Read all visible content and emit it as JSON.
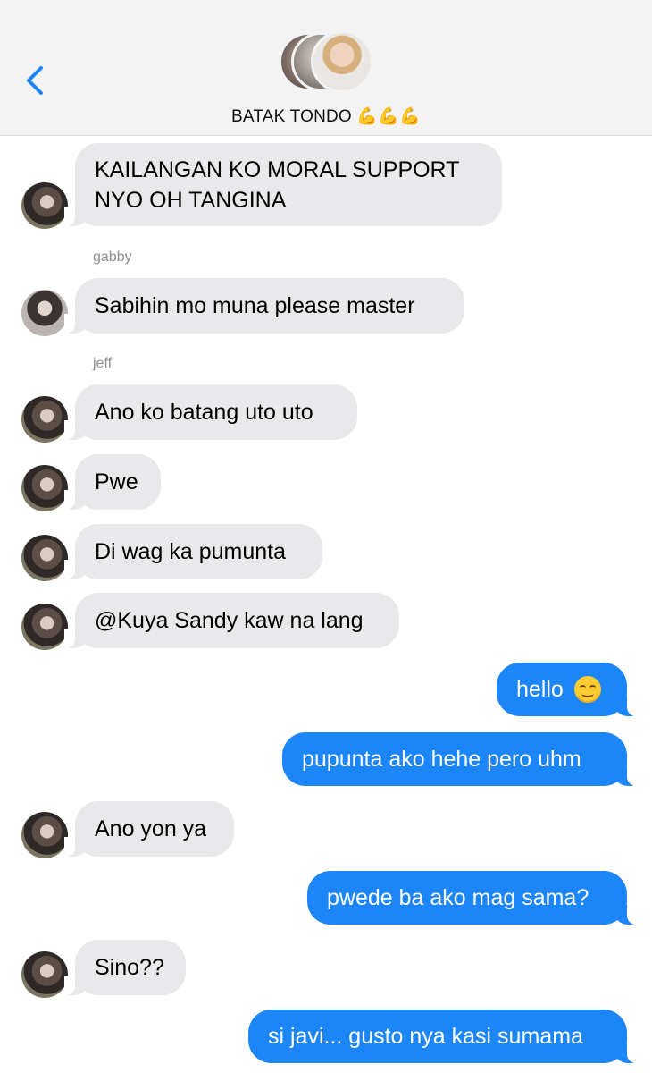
{
  "header": {
    "back_icon": "chevron-left-icon",
    "group_name": "BATAK TONDO 💪💪💪",
    "accent_color": "#1c86f8"
  },
  "messages": [
    {
      "direction": "incoming",
      "sender_label": "",
      "text_line1": "KAILANGAN KO MORAL SUPPORT",
      "text_line2": "NYO OH TANGINA"
    },
    {
      "direction": "incoming",
      "sender_label": "gabby",
      "text": "Sabihin mo muna please master"
    },
    {
      "direction": "incoming",
      "sender_label": "jeff",
      "text": "Ano ko batang uto uto"
    },
    {
      "direction": "incoming",
      "text": "Pwe"
    },
    {
      "direction": "incoming",
      "text": "Di wag ka pumunta"
    },
    {
      "direction": "incoming",
      "text": "@Kuya Sandy kaw na lang"
    },
    {
      "direction": "outgoing",
      "text": "hello",
      "emoji": "smiling-face-icon"
    },
    {
      "direction": "outgoing",
      "text": "pupunta ako hehe pero uhm"
    },
    {
      "direction": "incoming",
      "text": "Ano yon ya"
    },
    {
      "direction": "outgoing",
      "text": "pwede ba ako mag sama?"
    },
    {
      "direction": "incoming",
      "text": "Sino??"
    },
    {
      "direction": "outgoing",
      "text": "si javi... gusto nya kasi sumama"
    }
  ],
  "colors": {
    "incoming_bubble": "#e9e9eb",
    "outgoing_bubble": "#1c86f8",
    "sender_label": "#8e8e93"
  }
}
